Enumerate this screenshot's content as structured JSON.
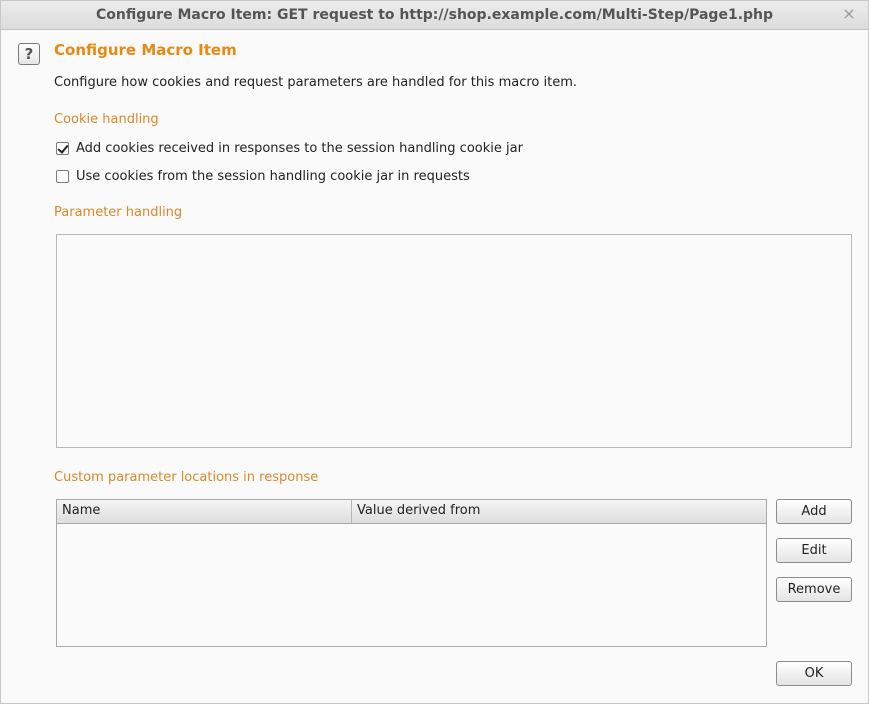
{
  "window": {
    "title": "Configure Macro Item: GET request to http://shop.example.com/Multi-Step/Page1.php",
    "close_glyph": "×"
  },
  "help": {
    "glyph": "?"
  },
  "heading": "Configure Macro Item",
  "description": "Configure how cookies and request parameters are handled for this macro item.",
  "cookie_handling": {
    "label": "Cookie handling",
    "options": [
      {
        "label": "Add cookies received in responses to the session handling cookie jar",
        "checked": true
      },
      {
        "label": "Use cookies from the session handling cookie jar in requests",
        "checked": false
      }
    ]
  },
  "parameter_handling": {
    "label": "Parameter handling"
  },
  "custom_locations": {
    "label": "Custom parameter locations in response",
    "columns": [
      "Name",
      "Value derived from"
    ],
    "rows": []
  },
  "buttons": {
    "add": "Add",
    "edit": "Edit",
    "remove": "Remove",
    "ok": "OK"
  },
  "colors": {
    "accent": "#e58a12",
    "section": "#d8892a"
  }
}
